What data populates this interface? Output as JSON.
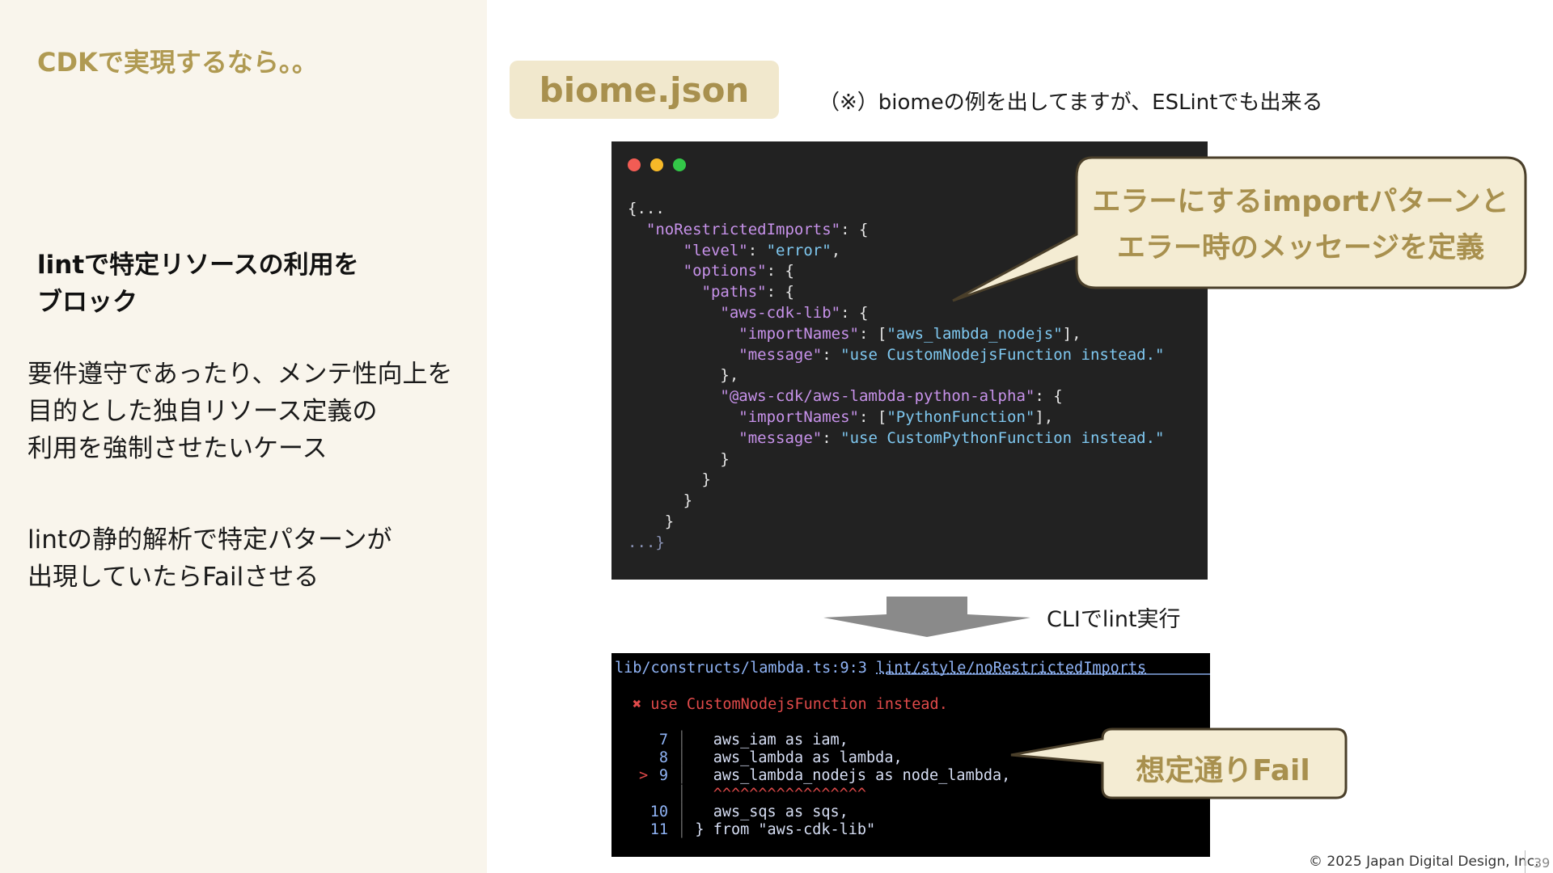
{
  "slide": {
    "title": "CDKで実現するなら。。",
    "heading_lines": [
      "lintで特定リソースの利用を",
      "ブロック"
    ],
    "paragraph1_lines": [
      "要件遵守であったり、メンテ性向上を",
      "目的とした独自リソース定義の",
      "利用を強制させたいケース"
    ],
    "paragraph2_lines": [
      "lintの静的解析で特定パターンが",
      "出現していたらFailさせる"
    ]
  },
  "config": {
    "file_badge": "biome.json",
    "note": "（※）biomeの例を出してますが、ESLintでも出来る",
    "code": {
      "open": "{...",
      "rule_key": "\"noRestrictedImports\"",
      "level_key": "\"level\"",
      "level_value": "\"error\"",
      "options_key": "\"options\"",
      "paths_key": "\"paths\"",
      "path1_key": "\"aws-cdk-lib\"",
      "import_names_key": "\"importNames\"",
      "path1_import": "\"aws_lambda_nodejs\"",
      "message_key": "\"message\"",
      "path1_message": "\"use CustomNodejsFunction instead.\"",
      "path2_key": "\"@aws-cdk/aws-lambda-python-alpha\"",
      "path2_import": "\"PythonFunction\"",
      "path2_message": "\"use CustomPythonFunction instead.\"",
      "close": "...}"
    }
  },
  "flow": {
    "cli_label": "CLIでlint実行"
  },
  "terminal": {
    "path": "lib/constructs/lambda.ts:9:3",
    "rule": "lint/style/noRestrictedImports",
    "error_icon": "✖",
    "error_message": "use CustomNodejsFunction instead.",
    "lines": [
      {
        "num": "7",
        "marker": "",
        "text": "aws_iam as iam,"
      },
      {
        "num": "8",
        "marker": "",
        "text": "aws_lambda as lambda,"
      },
      {
        "num": "9",
        "marker": ">",
        "text": "aws_lambda_nodejs as node_lambda,"
      },
      {
        "num": "",
        "marker": "",
        "text": "^^^^^^^^^^^^^^^^^"
      },
      {
        "num": "10",
        "marker": "",
        "text": "aws_sqs as sqs,"
      },
      {
        "num": "11",
        "marker": "",
        "text": "} from \"aws-cdk-lib\""
      }
    ]
  },
  "callouts": {
    "callout1_lines": [
      "エラーにするimportパターンと",
      "エラー時のメッセージを定義"
    ],
    "callout2": "想定通りFail"
  },
  "footer": {
    "copyright": "© 2025 Japan Digital Design, Inc.",
    "page_number": "39"
  },
  "colors": {
    "accent": "#a8904e",
    "left_bg": "#f9f5ec",
    "badge_bg": "#f1e8cd",
    "callout_bg": "#f4ecd3",
    "callout_border": "#4a3f2a",
    "code_bg": "#222222",
    "terminal_bg": "#000000"
  }
}
